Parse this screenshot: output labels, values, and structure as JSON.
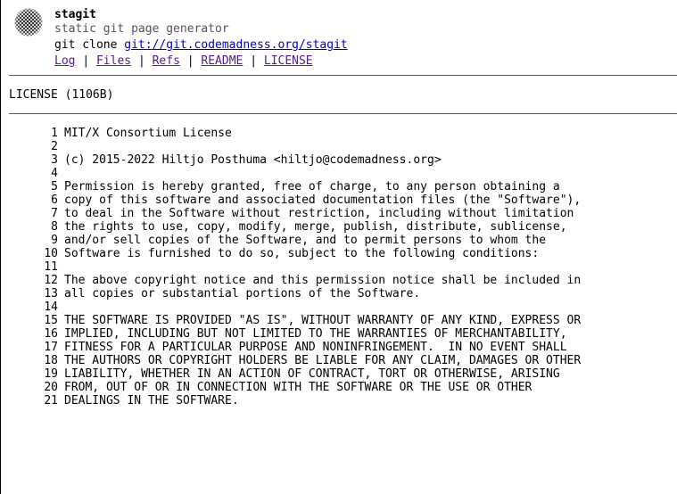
{
  "header": {
    "title": "stagit",
    "description": "static git page generator",
    "clone_prefix": "git clone",
    "clone_url": "git://git.codemadness.org/stagit",
    "logo_icon": "stagit-logo-icon"
  },
  "nav": {
    "items": [
      {
        "label": "Log"
      },
      {
        "label": "Files"
      },
      {
        "label": "Refs"
      },
      {
        "label": "README"
      },
      {
        "label": "LICENSE"
      }
    ],
    "separator": "|"
  },
  "file": {
    "title": "LICENSE (1106B)"
  },
  "code_lines": [
    {
      "n": "1",
      "text": "MIT/X Consortium License"
    },
    {
      "n": "2",
      "text": ""
    },
    {
      "n": "3",
      "text": "(c) 2015-2022 Hiltjo Posthuma <hiltjo@codemadness.org>"
    },
    {
      "n": "4",
      "text": ""
    },
    {
      "n": "5",
      "text": "Permission is hereby granted, free of charge, to any person obtaining a"
    },
    {
      "n": "6",
      "text": "copy of this software and associated documentation files (the \"Software\"),"
    },
    {
      "n": "7",
      "text": "to deal in the Software without restriction, including without limitation"
    },
    {
      "n": "8",
      "text": "the rights to use, copy, modify, merge, publish, distribute, sublicense,"
    },
    {
      "n": "9",
      "text": "and/or sell copies of the Software, and to permit persons to whom the"
    },
    {
      "n": "10",
      "text": "Software is furnished to do so, subject to the following conditions:"
    },
    {
      "n": "11",
      "text": ""
    },
    {
      "n": "12",
      "text": "The above copyright notice and this permission notice shall be included in"
    },
    {
      "n": "13",
      "text": "all copies or substantial portions of the Software."
    },
    {
      "n": "14",
      "text": ""
    },
    {
      "n": "15",
      "text": "THE SOFTWARE IS PROVIDED \"AS IS\", WITHOUT WARRANTY OF ANY KIND, EXPRESS OR"
    },
    {
      "n": "16",
      "text": "IMPLIED, INCLUDING BUT NOT LIMITED TO THE WARRANTIES OF MERCHANTABILITY,"
    },
    {
      "n": "17",
      "text": "FITNESS FOR A PARTICULAR PURPOSE AND NONINFRINGEMENT.  IN NO EVENT SHALL"
    },
    {
      "n": "18",
      "text": "THE AUTHORS OR COPYRIGHT HOLDERS BE LIABLE FOR ANY CLAIM, DAMAGES OR OTHER"
    },
    {
      "n": "19",
      "text": "LIABILITY, WHETHER IN AN ACTION OF CONTRACT, TORT OR OTHERWISE, ARISING"
    },
    {
      "n": "20",
      "text": "FROM, OUT OF OR IN CONNECTION WITH THE SOFTWARE OR THE USE OR OTHER"
    },
    {
      "n": "21",
      "text": "DEALINGS IN THE SOFTWARE."
    }
  ]
}
